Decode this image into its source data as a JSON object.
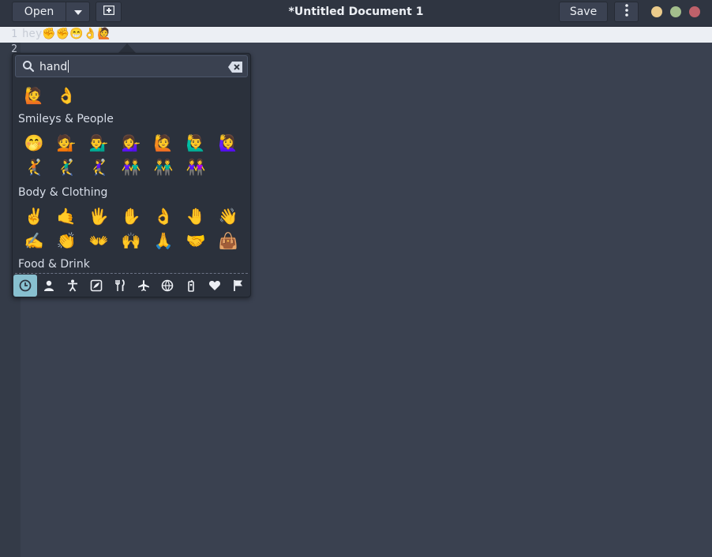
{
  "window": {
    "title": "*Untitled Document 1",
    "buttons": {
      "open": "Open",
      "save": "Save"
    }
  },
  "editor": {
    "line_numbers": [
      "1",
      "2"
    ],
    "line1_text": "hey✊✊😁👌🙋"
  },
  "emoji_chooser": {
    "search": {
      "value": "hand"
    },
    "recent": [
      "🙋",
      "👌"
    ],
    "sections": [
      {
        "title": "Smileys & People",
        "rows": [
          [
            "🤭",
            "💁",
            "💁‍♂️",
            "💁‍♀️",
            "🙋",
            "🙋‍♂️",
            "🙋‍♀️"
          ],
          [
            "🤾",
            "🤾‍♂️",
            "🤾‍♀️",
            "👫",
            "👬",
            "👭"
          ]
        ]
      },
      {
        "title": "Body & Clothing",
        "rows": [
          [
            "✌️",
            "🤙",
            "🖐️",
            "✋",
            "👌",
            "🤚",
            "👋"
          ],
          [
            "✍️",
            "👏",
            "👐",
            "🙌",
            "🙏",
            "🤝",
            "👜"
          ]
        ]
      },
      {
        "title": "Food & Drink",
        "rows": []
      }
    ],
    "categories": [
      {
        "icon": "clock-icon",
        "glyph": "",
        "active": true
      },
      {
        "icon": "person-icon",
        "glyph": ""
      },
      {
        "icon": "body-icon",
        "glyph": ""
      },
      {
        "icon": "nature-icon",
        "glyph": ""
      },
      {
        "icon": "food-icon",
        "glyph": ""
      },
      {
        "icon": "travel-icon",
        "glyph": "✈"
      },
      {
        "icon": "activities-icon",
        "glyph": ""
      },
      {
        "icon": "objects-icon",
        "glyph": ""
      },
      {
        "icon": "symbols-icon",
        "glyph": "♥"
      },
      {
        "icon": "flags-icon",
        "glyph": "⚑"
      }
    ]
  },
  "colors": {
    "accent": "#88c0d0",
    "background": "#3a4150",
    "headerbar": "#2f3541"
  }
}
